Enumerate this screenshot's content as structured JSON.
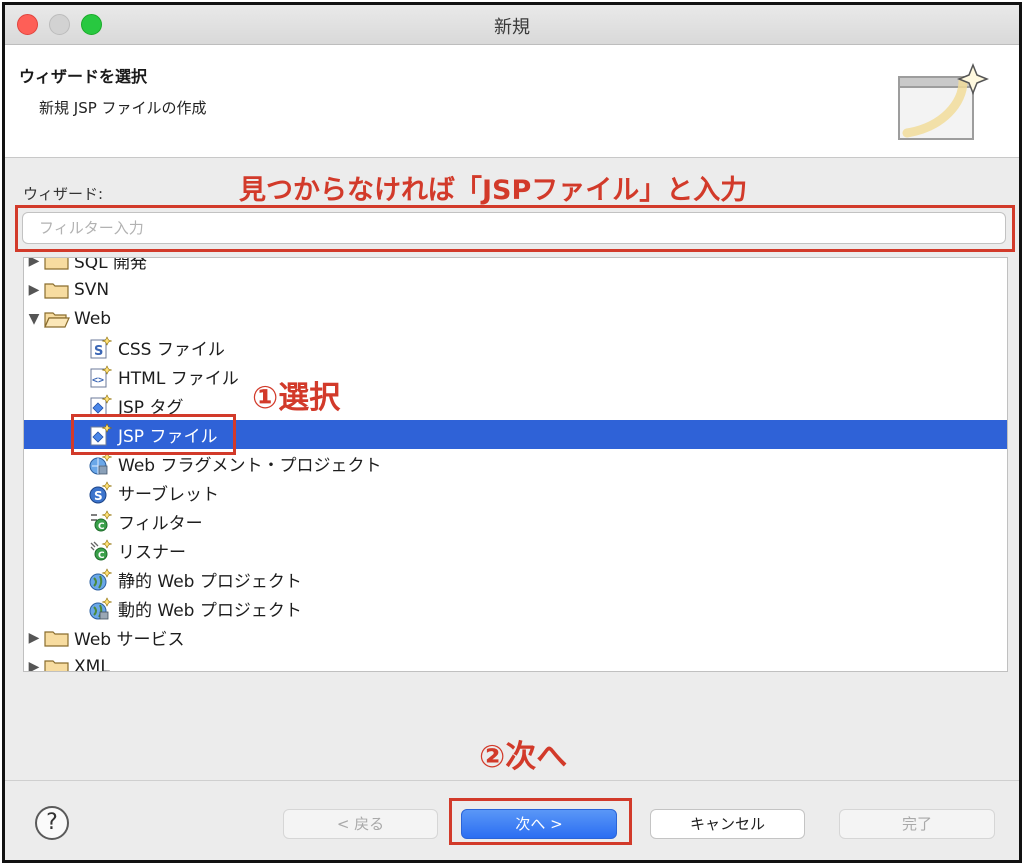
{
  "window": {
    "title": "新規"
  },
  "header": {
    "title": "ウィザードを選択",
    "description": "新規 JSP ファイルの作成"
  },
  "wizards": {
    "label": "ウィザード:",
    "filter_placeholder": "フィルター入力",
    "filter_value": ""
  },
  "annotations": {
    "search_hint": "見つからなければ「JSPファイル」と入力",
    "step1": "①選択",
    "step2": "②次へ"
  },
  "tree": {
    "items": [
      {
        "label": "SQL 開発",
        "type": "folder",
        "expanded": false
      },
      {
        "label": "SVN",
        "type": "folder",
        "expanded": false
      },
      {
        "label": "Web",
        "type": "folder",
        "expanded": true
      },
      {
        "label": "CSS ファイル",
        "type": "css-file"
      },
      {
        "label": "HTML ファイル",
        "type": "html-file"
      },
      {
        "label": "JSP タグ",
        "type": "jsp-tag"
      },
      {
        "label": "JSP ファイル",
        "type": "jsp-file",
        "selected": true
      },
      {
        "label": "Web フラグメント・プロジェクト",
        "type": "web-fragment-project"
      },
      {
        "label": "サーブレット",
        "type": "servlet"
      },
      {
        "label": "フィルター",
        "type": "filter"
      },
      {
        "label": "リスナー",
        "type": "listener"
      },
      {
        "label": "静的 Web プロジェクト",
        "type": "static-web-project"
      },
      {
        "label": "動的 Web プロジェクト",
        "type": "dynamic-web-project"
      },
      {
        "label": "Web サービス",
        "type": "folder",
        "expanded": false
      },
      {
        "label": "XML",
        "type": "folder",
        "expanded": false
      }
    ]
  },
  "buttons": {
    "help": "?",
    "back": "< 戻る",
    "next": "次へ >",
    "cancel": "キャンセル",
    "finish": "完了"
  },
  "colors": {
    "selection": "#2f62d7",
    "annotation": "#d23a2a",
    "primary_button": "#2b6ef2"
  }
}
